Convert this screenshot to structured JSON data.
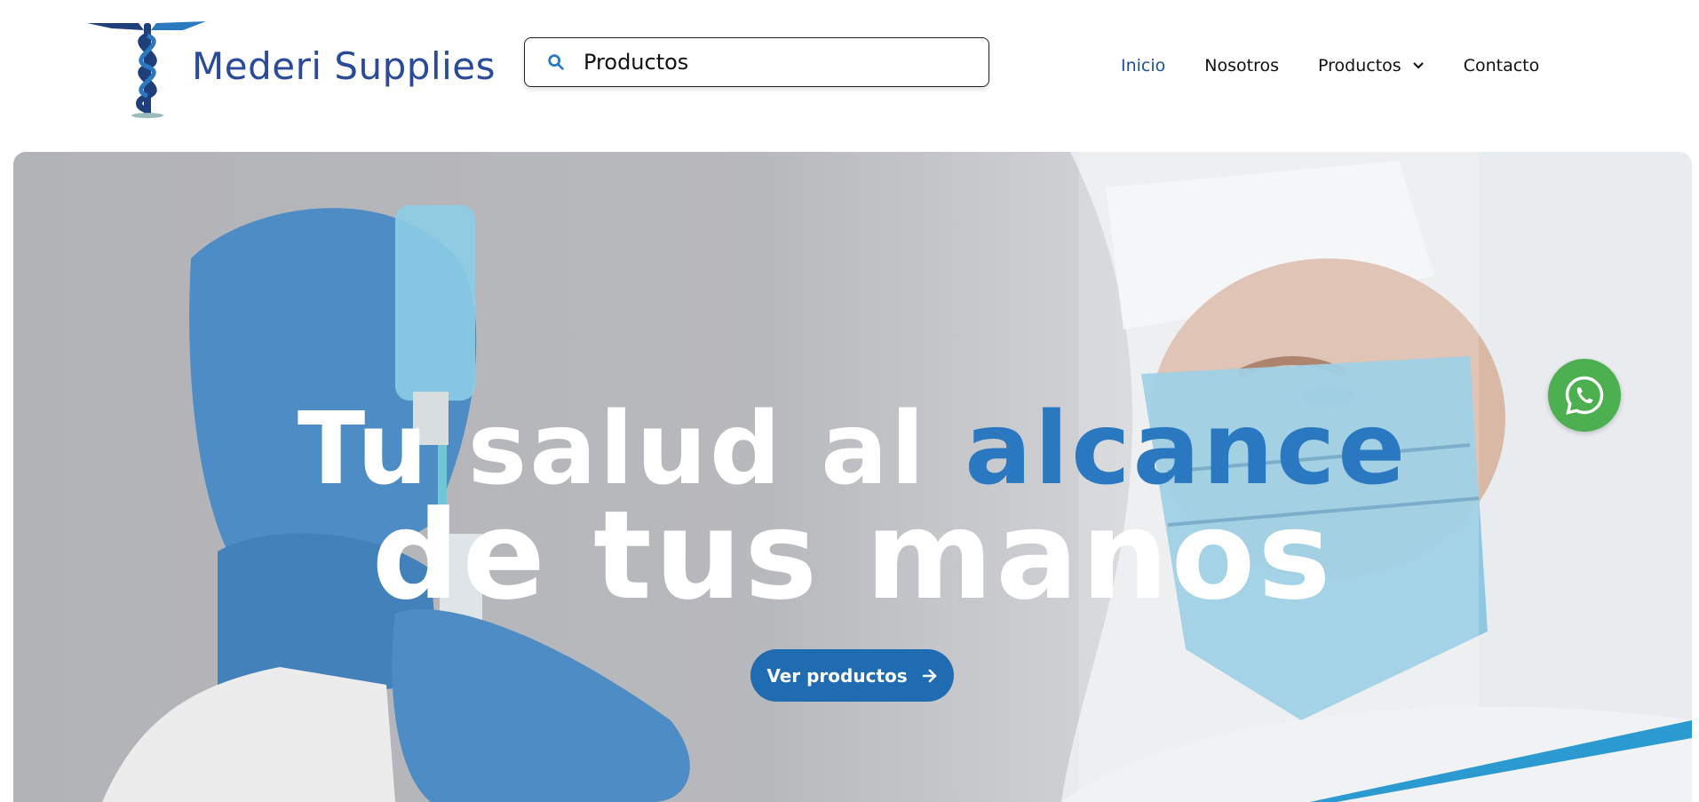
{
  "brand": {
    "name": "Mederi Supplies",
    "logo_icon": "caduceus-icon",
    "color": "#2a4a9a"
  },
  "search": {
    "value": "Productos",
    "placeholder": "",
    "icon": "search-icon"
  },
  "nav": {
    "items": [
      {
        "label": "Inicio",
        "active": true
      },
      {
        "label": "Nosotros",
        "active": false
      },
      {
        "label": "Productos",
        "active": false,
        "has_dropdown": true
      },
      {
        "label": "Contacto",
        "active": false
      }
    ]
  },
  "hero": {
    "headline_part1": "Tu salud al",
    "headline_accent": "alcance",
    "headline_line2": "de tus manos",
    "cta_label": "Ver productos",
    "accent_color": "#2a78c0",
    "button_color": "#1f6cb2"
  },
  "floating": {
    "whatsapp_icon": "whatsapp-icon",
    "color": "#4caf50"
  }
}
